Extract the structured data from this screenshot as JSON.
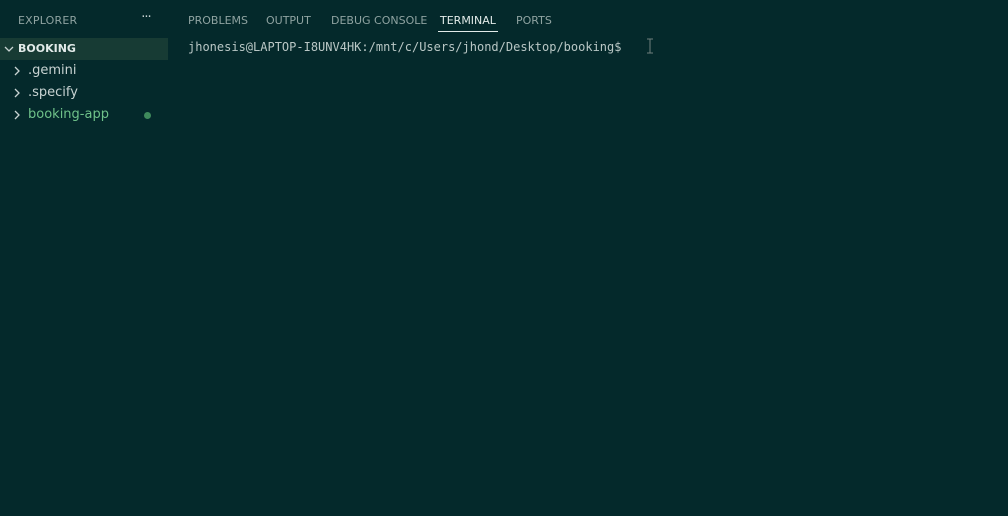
{
  "explorer": {
    "title": "EXPLORER",
    "more_actions": "···",
    "workspace": "BOOKING",
    "items": [
      {
        "label": ".gemini",
        "modified": false
      },
      {
        "label": ".specify",
        "modified": false
      },
      {
        "label": "booking-app",
        "modified": true
      }
    ]
  },
  "panel": {
    "tabs": [
      {
        "label": "PROBLEMS",
        "active": false
      },
      {
        "label": "OUTPUT",
        "active": false
      },
      {
        "label": "DEBUG CONSOLE",
        "active": false
      },
      {
        "label": "TERMINAL",
        "active": true
      },
      {
        "label": "PORTS",
        "active": false
      }
    ]
  },
  "terminal": {
    "prompt": "jhonesis@LAPTOP-I8UNV4HK:/mnt/c/Users/jhond/Desktop/booking$"
  },
  "colors": {
    "background": "#04292b",
    "selected_row": "#173b34",
    "modified_text": "#6fc28a",
    "modified_dot": "#3f8a5c"
  }
}
